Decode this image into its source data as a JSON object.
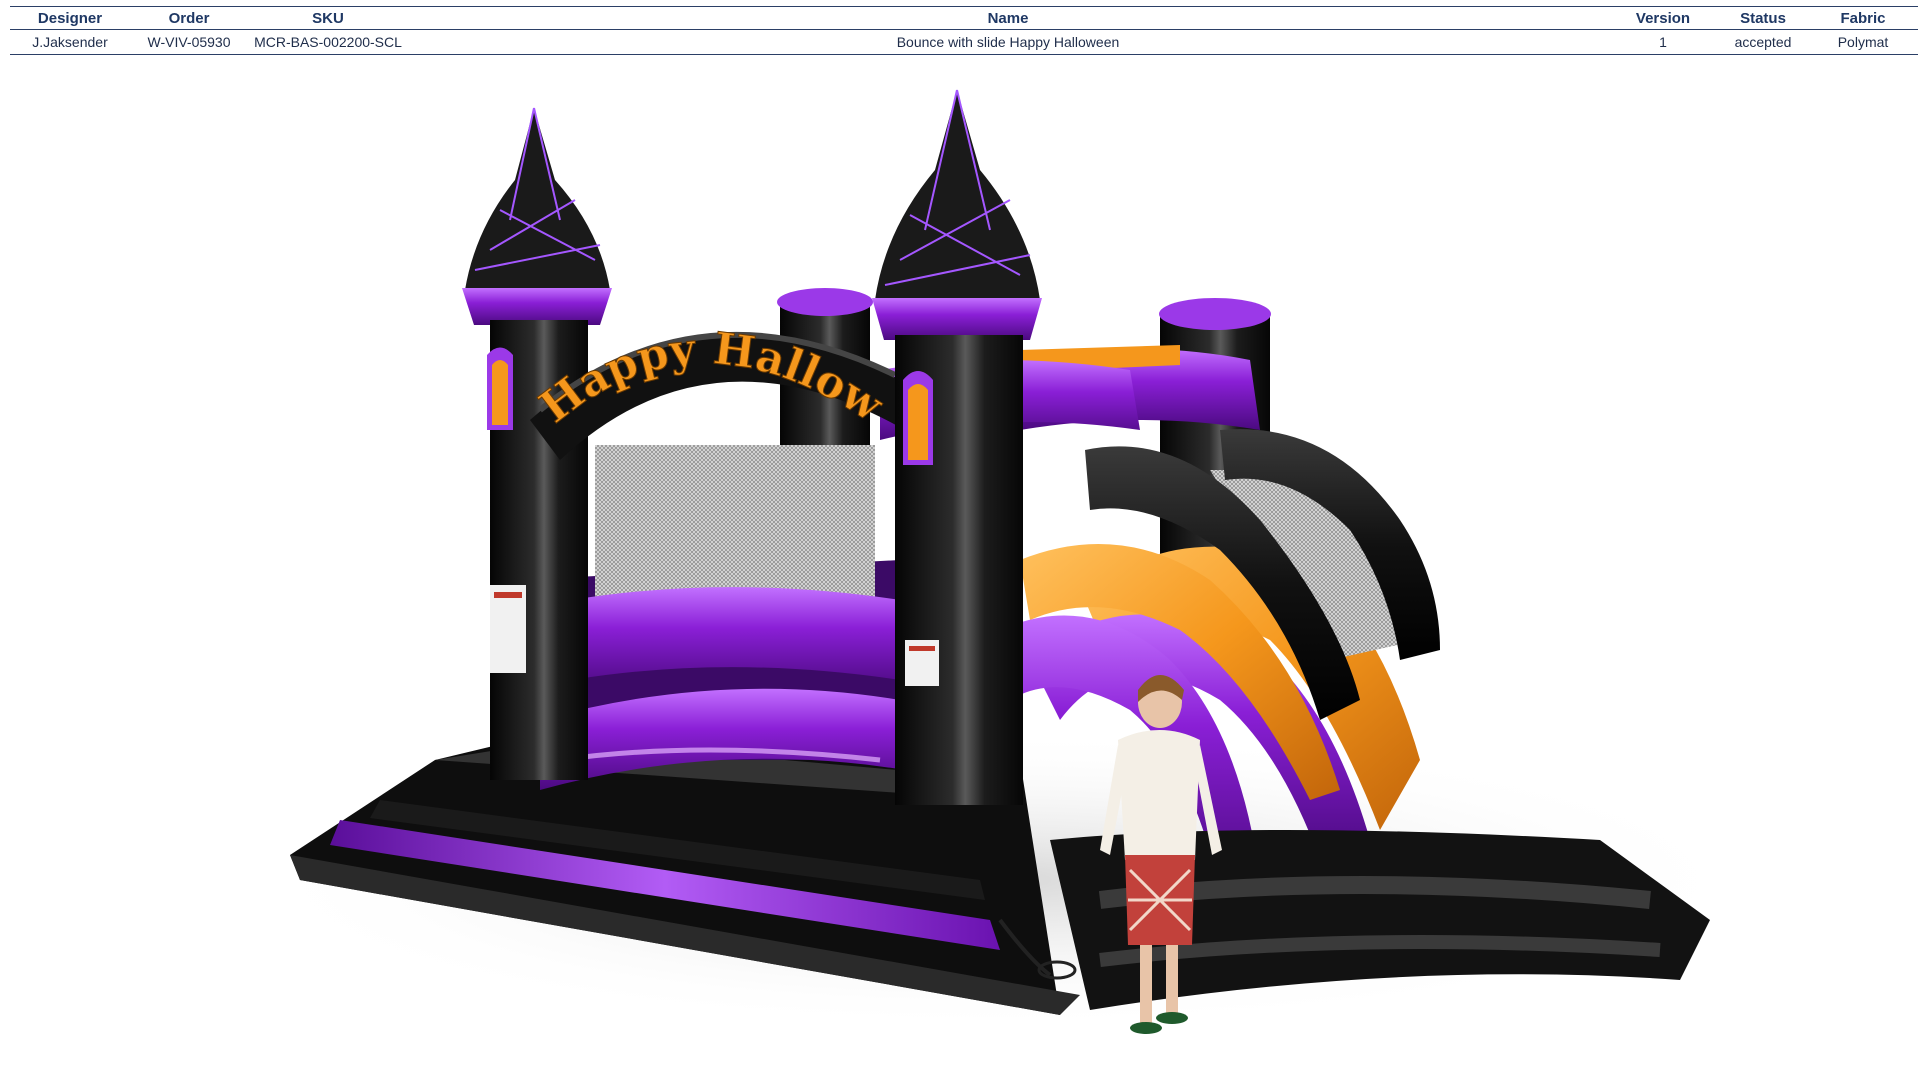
{
  "table": {
    "headers": [
      "Designer",
      "Order",
      "SKU",
      "Name",
      "Version",
      "Status",
      "Fabric"
    ],
    "row": [
      "J.Jaksender",
      "W-VIV-05930",
      "MCR-BAS-002200-SCL",
      "Bounce with slide Happy Halloween",
      "1",
      "accepted",
      "Polymat"
    ]
  },
  "render": {
    "arch_text": "Happy Halloween",
    "colors": {
      "purple": "#8a1fd6",
      "black": "#141414",
      "orange": "#f5971c",
      "background": "#ffffff"
    }
  }
}
